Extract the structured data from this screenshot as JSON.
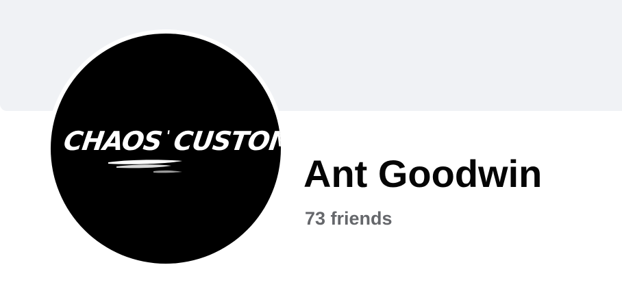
{
  "profile": {
    "name": "Ant Goodwin",
    "friends_text": "73 friends",
    "avatar": {
      "logo_text": "CHAOS CUSTOMZ",
      "logo_left": "CHAOS",
      "logo_right": "CUSTOMZ",
      "background_color": "#000000",
      "logo_color": "#ffffff"
    }
  },
  "colors": {
    "cover_background": "#f0f2f5",
    "name_text": "#050505",
    "secondary_text": "#65676b"
  }
}
